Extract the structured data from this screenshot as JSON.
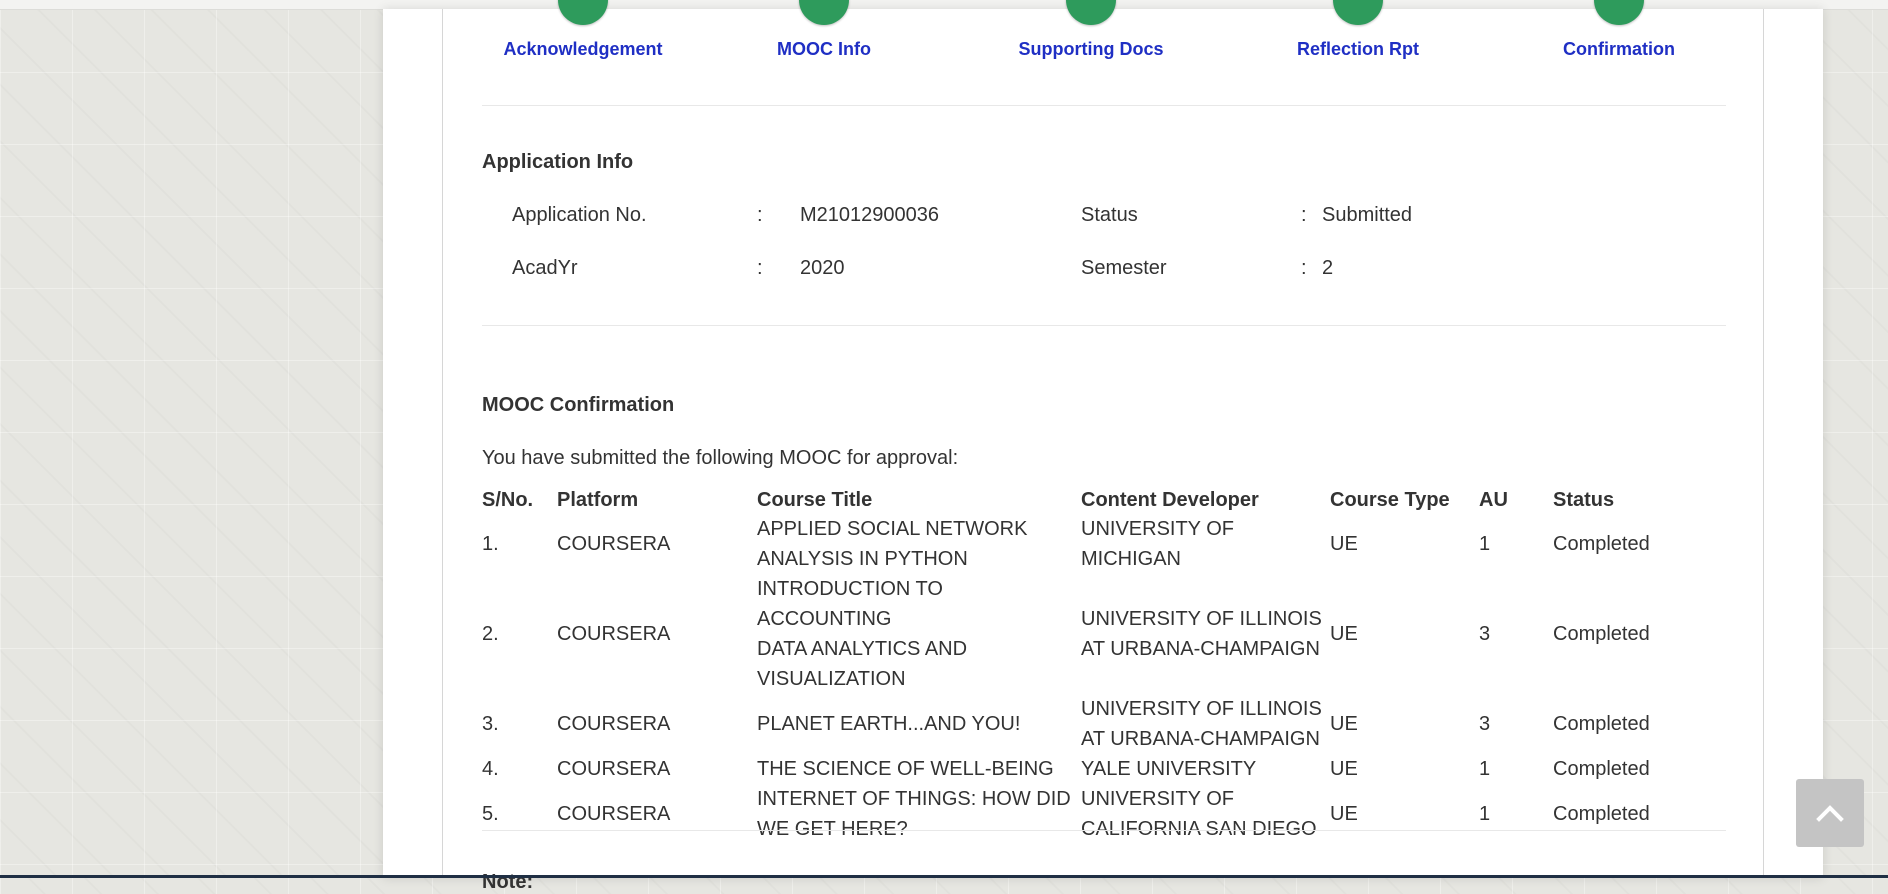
{
  "steps": [
    "Acknowledgement",
    "MOOC Info",
    "Supporting Docs",
    "Reflection Rpt",
    "Confirmation"
  ],
  "application_info": {
    "title": "Application Info",
    "fields": [
      {
        "label": "Application No.",
        "value": "M21012900036"
      },
      {
        "label": "Status",
        "value": "Submitted"
      },
      {
        "label": "AcadYr",
        "value": "2020"
      },
      {
        "label": "Semester",
        "value": "2"
      }
    ],
    "separator": ":"
  },
  "mooc_confirmation": {
    "title": "MOOC Confirmation",
    "intro": "You have submitted the following MOOC for approval:",
    "columns": [
      "S/No.",
      "Platform",
      "Course Title",
      "Content Developer",
      "Course Type",
      "AU",
      "Status"
    ],
    "rows": [
      {
        "sno": "1.",
        "platform": "COURSERA",
        "title_lines": [
          "APPLIED SOCIAL NETWORK",
          "ANALYSIS IN PYTHON"
        ],
        "developer_lines": [
          "UNIVERSITY OF",
          "MICHIGAN"
        ],
        "type": "UE",
        "au": "1",
        "status": "Completed"
      },
      {
        "sno": "2.",
        "platform": "COURSERA",
        "title_lines": [
          "INTRODUCTION TO ACCOUNTING",
          "DATA ANALYTICS AND",
          "VISUALIZATION"
        ],
        "developer_lines": [
          "UNIVERSITY OF ILLINOIS",
          "AT URBANA-CHAMPAIGN"
        ],
        "type": "UE",
        "au": "3",
        "status": "Completed"
      },
      {
        "sno": "3.",
        "platform": "COURSERA",
        "title_lines": [
          "PLANET EARTH...AND YOU!"
        ],
        "developer_lines": [
          "UNIVERSITY OF ILLINOIS",
          "AT URBANA-CHAMPAIGN"
        ],
        "type": "UE",
        "au": "3",
        "status": "Completed"
      },
      {
        "sno": "4.",
        "platform": "COURSERA",
        "title_lines": [
          "THE SCIENCE OF WELL-BEING"
        ],
        "developer_lines": [
          "YALE UNIVERSITY"
        ],
        "type": "UE",
        "au": "1",
        "status": "Completed"
      },
      {
        "sno": "5.",
        "platform": "COURSERA",
        "title_lines": [
          "INTERNET OF THINGS: HOW DID",
          "WE GET HERE?"
        ],
        "developer_lines": [
          "UNIVERSITY OF",
          "CALIFORNIA SAN DIEGO"
        ],
        "type": "UE",
        "au": "1",
        "status": "Completed"
      }
    ]
  },
  "note_label": "Note:",
  "icons": {
    "back_to_top": "chevron-up-icon"
  },
  "colors": {
    "step_dot": "#2e9b5c",
    "step_label": "#1f2fc4"
  }
}
